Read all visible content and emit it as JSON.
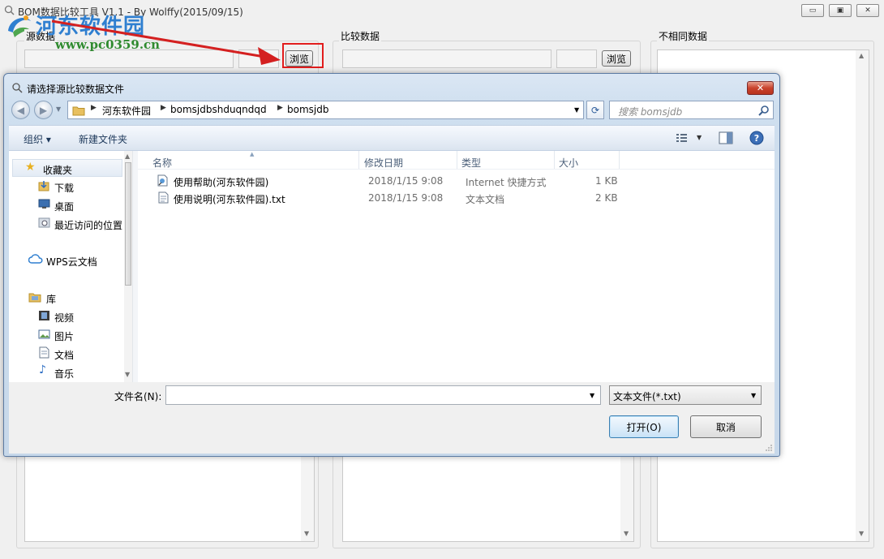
{
  "app": {
    "title": "BOM数据比较工具 V1.1 - By Wolffy(2015/09/15)",
    "minimize_glyph": "▭",
    "maximize_glyph": "▣",
    "close_glyph": "✕"
  },
  "watermark": {
    "text": "河东软件园",
    "url": "www.pc0359.cn"
  },
  "groups": {
    "source": {
      "label": "源数据",
      "browse_label": "浏览"
    },
    "compare": {
      "label": "比较数据",
      "browse_label": "浏览"
    },
    "diff": {
      "label": "不相同数据"
    }
  },
  "dialog": {
    "title": "请选择源比较数据文件",
    "close_glyph": "✕",
    "breadcrumb": [
      "河东软件园",
      "bomsjdbshduqndqd",
      "bomsjdb"
    ],
    "search_placeholder": "搜索 bomsjdb",
    "toolbar": {
      "organize": "组织 ▾",
      "new_folder": "新建文件夹"
    },
    "nav": {
      "favorites": "收藏夹",
      "downloads": "下载",
      "desktop": "桌面",
      "recent": "最近访问的位置",
      "wps": "WPS云文档",
      "libraries": "库",
      "videos": "视频",
      "pictures": "图片",
      "documents": "文档",
      "music": "音乐"
    },
    "columns": {
      "name": "名称",
      "date": "修改日期",
      "type": "类型",
      "size": "大小"
    },
    "files": [
      {
        "name": "使用帮助(河东软件园)",
        "date": "2018/1/15 9:08",
        "type": "Internet 快捷方式",
        "size": "1 KB"
      },
      {
        "name": "使用说明(河东软件园).txt",
        "date": "2018/1/15 9:08",
        "type": "文本文档",
        "size": "2 KB"
      }
    ],
    "filename_label": "文件名(N):",
    "filename_value": "",
    "filetype_value": "文本文件(*.txt)",
    "open_label": "打开(O)",
    "cancel_label": "取消"
  },
  "colors": {
    "highlight": "#e21d1d",
    "arrow": "#d42020",
    "watermark_blue": "#2f7fd0",
    "watermark_green": "#2f8a2f"
  }
}
